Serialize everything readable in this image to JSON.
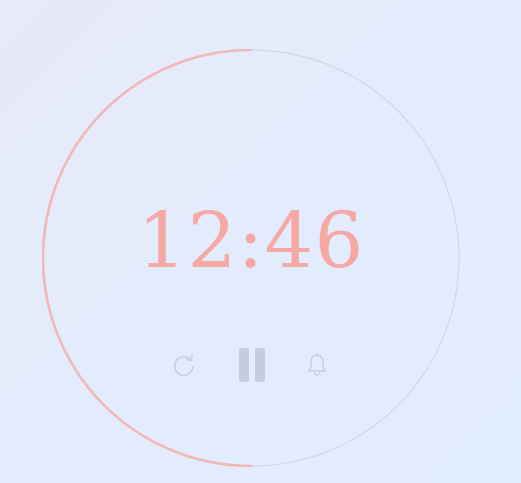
{
  "timer": {
    "display": "12:46",
    "progress": 0.5,
    "colors": {
      "progress": "#f3b7b6",
      "track": "#cfd7e3",
      "time": "#f6a9a4",
      "controls_muted": "#c6cfdb",
      "pause": "#c3cddb"
    }
  },
  "controls": {
    "reset_icon": "refresh-icon",
    "pause_icon": "pause-icon",
    "alarm_icon": "bell-icon"
  }
}
